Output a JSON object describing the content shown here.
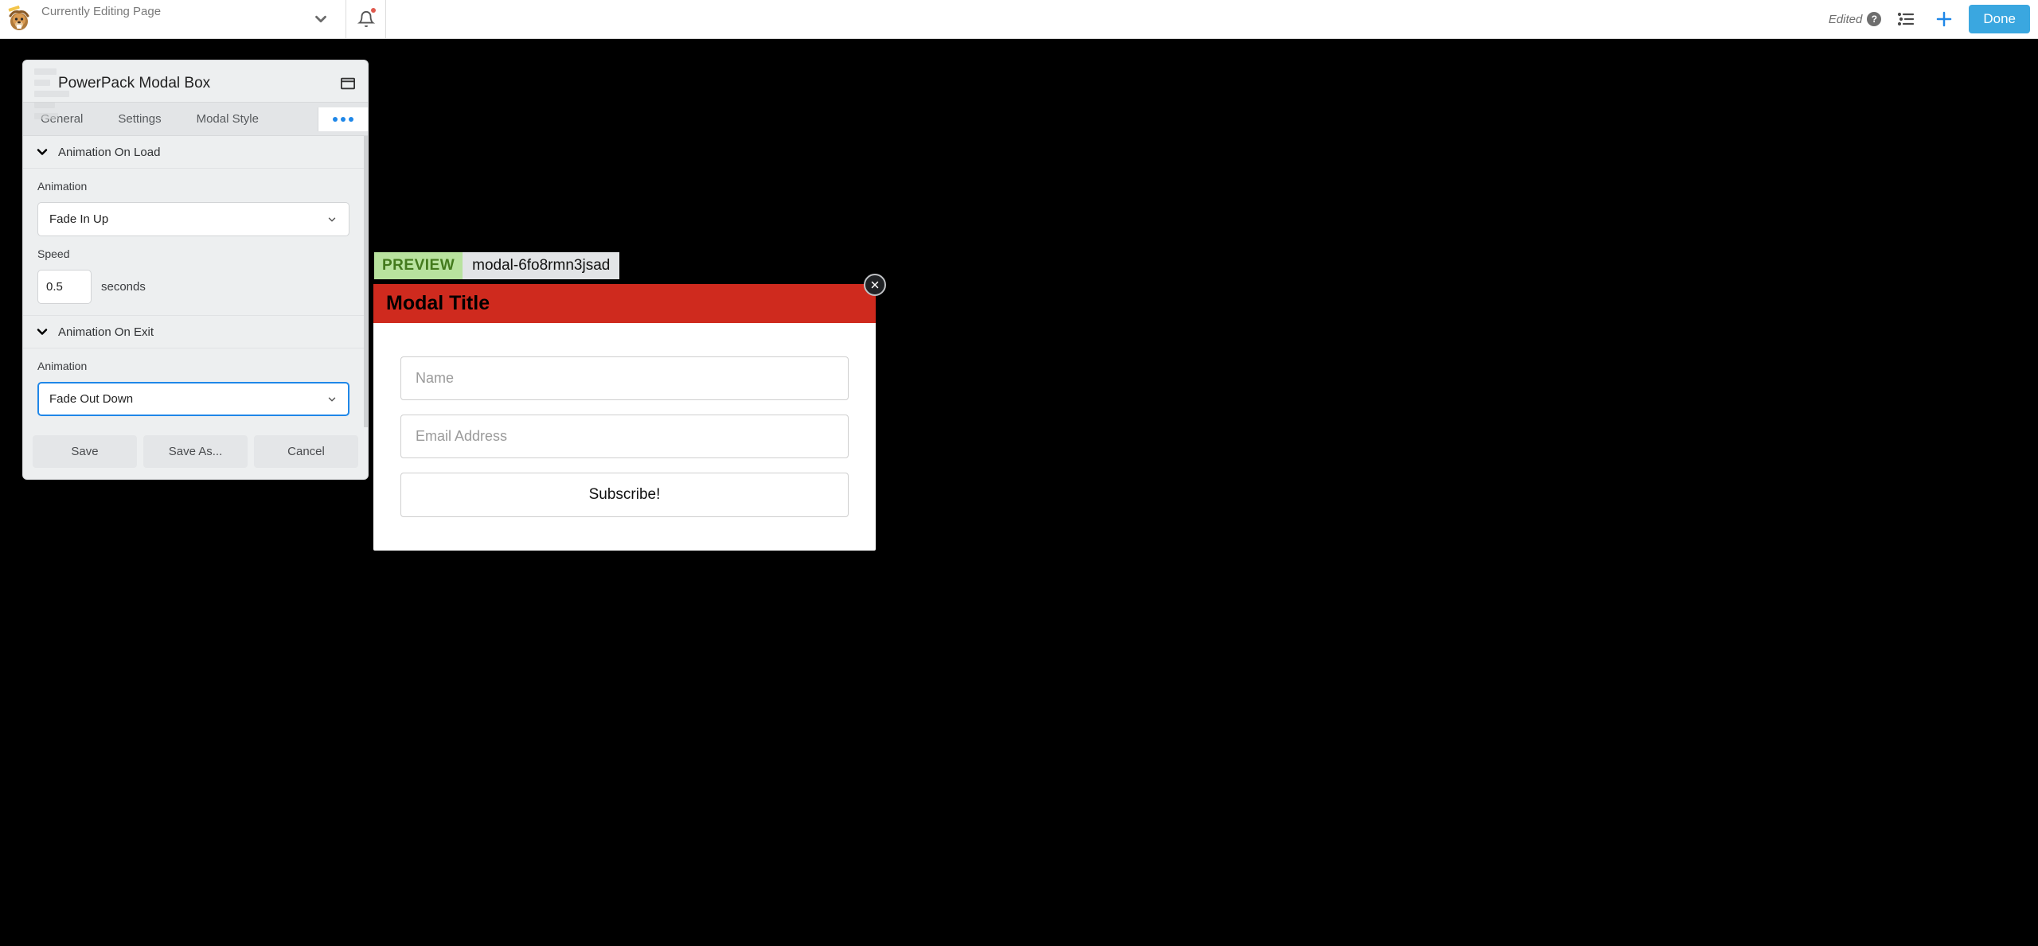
{
  "topbar": {
    "page_title": "Currently Editing Page",
    "edited_label": "Edited",
    "done_label": "Done"
  },
  "panel": {
    "title": "PowerPack Modal Box",
    "tabs": {
      "general": "General",
      "settings": "Settings",
      "modal_style": "Modal Style"
    },
    "sections": {
      "load": {
        "title": "Animation On Load",
        "animation_label": "Animation",
        "animation_value": "Fade In Up",
        "speed_label": "Speed",
        "speed_value": "0.5",
        "speed_unit": "seconds"
      },
      "exit": {
        "title": "Animation On Exit",
        "animation_label": "Animation",
        "animation_value": "Fade Out Down"
      }
    },
    "footer": {
      "save": "Save",
      "save_as": "Save As...",
      "cancel": "Cancel"
    }
  },
  "preview": {
    "badge": "PREVIEW",
    "id": "modal-6fo8rmn3jsad",
    "modal_title": "Modal Title",
    "name_placeholder": "Name",
    "email_placeholder": "Email Address",
    "submit_label": "Subscribe!"
  }
}
